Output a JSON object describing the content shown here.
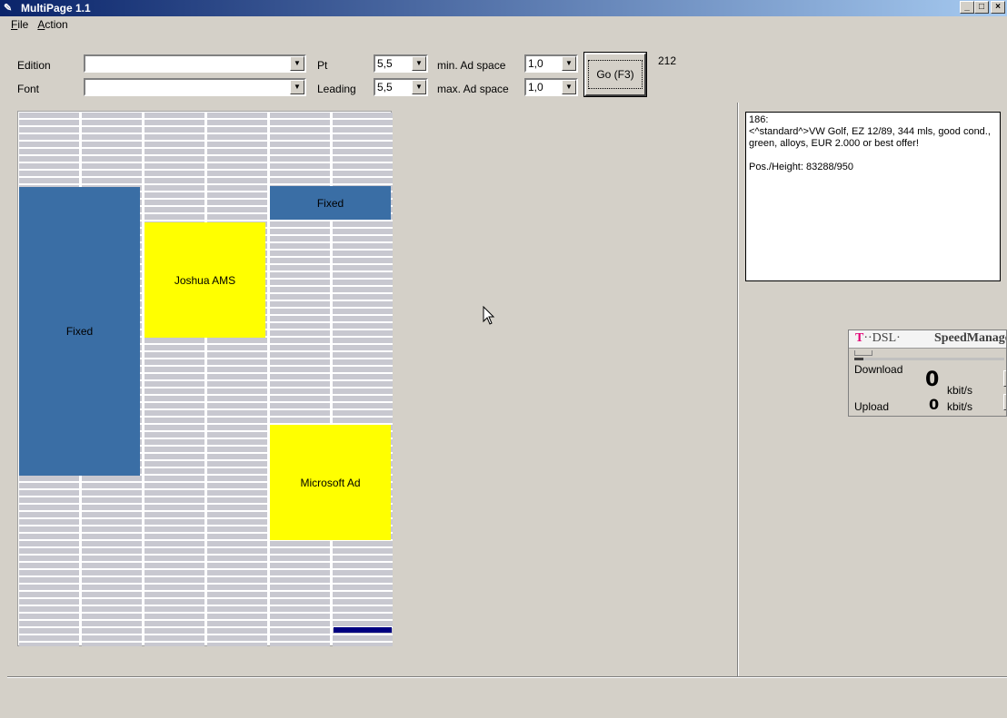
{
  "window": {
    "title": "MultiPage 1.1",
    "minimize": "_",
    "maximize": "□",
    "close": "×"
  },
  "menu": [
    {
      "label": "File",
      "accel": "F",
      "rest": "ile"
    },
    {
      "label": "Action",
      "accel": "A",
      "rest": "ction"
    }
  ],
  "toolbar": {
    "edition_label": "Edition",
    "edition_value": "",
    "font_label": "Font",
    "font_value": "",
    "pt_label": "Pt",
    "pt_value": "5,5",
    "leading_label": "Leading",
    "leading_value": "5,5",
    "min_ad_label": "min. Ad space",
    "min_ad_value": "1,0",
    "max_ad_label": "max. Ad space",
    "max_ad_value": "1,0",
    "go_label": "Go (F3)",
    "count": "212"
  },
  "layout": {
    "ads": [
      {
        "label": "Fixed",
        "kind": "fixed"
      },
      {
        "label": "Joshua AMS",
        "kind": "yellow"
      },
      {
        "label": "Fixed",
        "kind": "fixed"
      },
      {
        "label": "Microsoft Ad",
        "kind": "yellow"
      }
    ]
  },
  "info_panel": {
    "text": "186:\n<^standard^>VW Golf, EZ 12/89, 344 mls, good cond., green, alloys, EUR 2.000 or best offer!\n\nPos./Height: 83288/950"
  },
  "dsl_widget": {
    "brand_t": "T",
    "brand_rest": "··DSL·",
    "product": "SpeedManager",
    "download_label": "Download",
    "download_value": "0",
    "download_unit": "kbit/s",
    "upload_label": "Upload",
    "upload_value": "0",
    "upload_unit": "kbit/s"
  },
  "colors": {
    "fixed_ad": "#3a6ea5",
    "placed_ad": "#ffff00",
    "titlebar": "#0a246a"
  }
}
